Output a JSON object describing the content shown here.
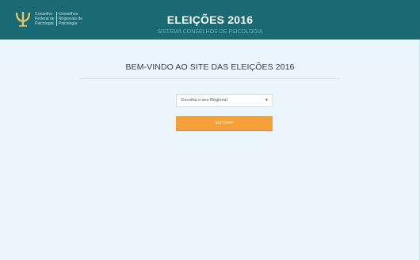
{
  "header": {
    "title": "ELEIÇÕES 2016",
    "subtitle": "SISTEMA CONSELHOS DE PSICOLOGIA",
    "logo": {
      "col1": [
        "Conselho",
        "Federal de",
        "Psicologia"
      ],
      "col2": [
        "Conselhos",
        "Regionais de",
        "Psicologia"
      ]
    }
  },
  "main": {
    "welcome": "BEM-VINDO AO SITE DAS ELEIÇÕES 2016",
    "regional_select": {
      "selected": "Escolha o seu Regional"
    },
    "enter_label": "ENTRAR"
  },
  "colors": {
    "header_bg": "#1a6a73",
    "page_bg": "#eaf6fb",
    "button_bg": "#f7a03a"
  }
}
